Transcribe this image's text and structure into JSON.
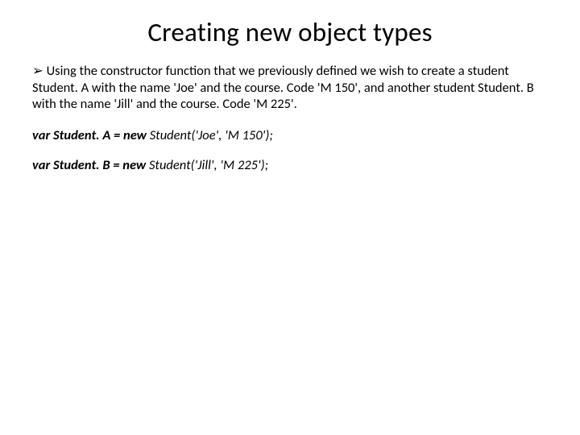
{
  "title": "Creating new object types",
  "bullet": {
    "glyph": "➢",
    "text": "Using the constructor function that we previously defined we wish to create a student Student. A with the name 'Joe' and the course. Code 'M 150', and another student Student. B with the name 'Jill' and the course. Code 'M 225'."
  },
  "code_lines": [
    {
      "lead": "var Student. A = new ",
      "rest": "Student('Joe', 'M 150');"
    },
    {
      "lead": "var Student. B = new ",
      "rest": "Student('Jill', 'M 225');"
    }
  ]
}
